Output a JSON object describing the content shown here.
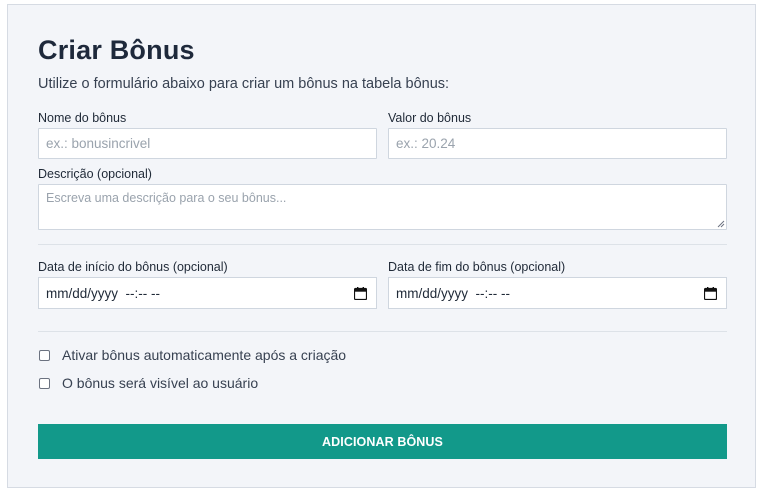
{
  "form": {
    "title": "Criar Bônus",
    "subtitle": "Utilize o formulário abaixo para criar um bônus na tabela bônus:",
    "name": {
      "label": "Nome do bônus",
      "placeholder": "ex.: bonusincrivel",
      "value": ""
    },
    "value": {
      "label": "Valor do bônus",
      "placeholder": "ex.: 20.24",
      "value": ""
    },
    "description": {
      "label": "Descrição (opcional)",
      "placeholder": "Escreva uma descrição para o seu bônus...",
      "value": ""
    },
    "start_date": {
      "label": "Data de início do bônus (opcional)",
      "display": "mm/dd/yyyy  --:-- --",
      "icon": "calendar-icon"
    },
    "end_date": {
      "label": "Data de fim do bônus (opcional)",
      "display": "mm/dd/yyyy  --:-- --",
      "icon": "calendar-icon"
    },
    "checkboxes": [
      {
        "label": "Ativar bônus automaticamente após a criação",
        "checked": false
      },
      {
        "label": "O bônus será visível ao usuário",
        "checked": false
      }
    ],
    "submit_label": "ADICIONAR BÔNUS"
  },
  "colors": {
    "accent": "#12998a",
    "background": "#f3f5f9",
    "border": "#cfd6df"
  }
}
